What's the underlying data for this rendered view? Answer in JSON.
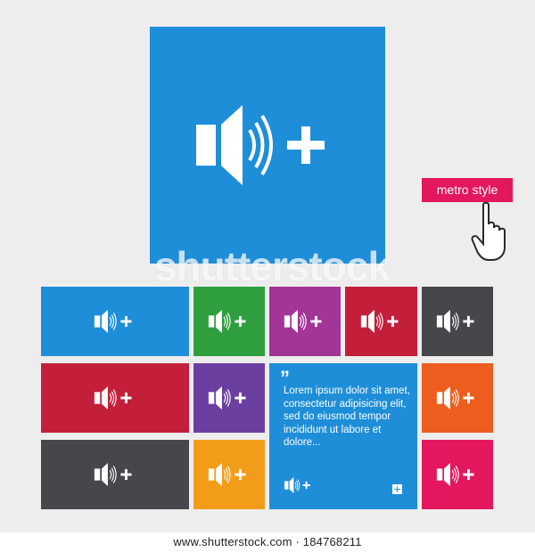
{
  "watermark_text": "shutterstock",
  "badge_label": "metro style",
  "lorem_text": "Lorem ipsum dolor sit amet, consectetur adipisicing elit, sed do eiusmod tempor incididunt ut labore et dolore...",
  "quote_mark": "”",
  "footer_text": "www.shutterstock.com · 184768211",
  "colors": {
    "background": "#ededed",
    "big_tile": "#1e8ed8",
    "badge": "#e2175e"
  },
  "icon": "speaker-volume-up-plus-icon",
  "tiles": [
    {
      "name": "tile-blue-wide",
      "color": "#1e8ed8"
    },
    {
      "name": "tile-green",
      "color": "#2f9e3f"
    },
    {
      "name": "tile-purple",
      "color": "#a23596"
    },
    {
      "name": "tile-red",
      "color": "#c31f3a"
    },
    {
      "name": "tile-dark-gray",
      "color": "#46474b"
    },
    {
      "name": "tile-red-wide",
      "color": "#c31f3a"
    },
    {
      "name": "tile-violet",
      "color": "#6b3fa0"
    },
    {
      "name": "tile-orange",
      "color": "#ec5d1e"
    },
    {
      "name": "tile-dark-gray-wide",
      "color": "#46474b"
    },
    {
      "name": "tile-yellow-orange",
      "color": "#f39c19"
    },
    {
      "name": "tile-pink",
      "color": "#e2175e"
    }
  ]
}
